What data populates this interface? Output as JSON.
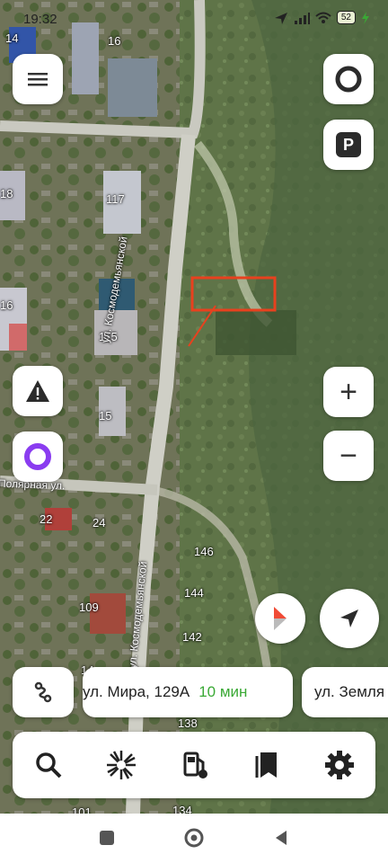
{
  "status_bar": {
    "time": "19:32",
    "battery": "52"
  },
  "map": {
    "house_numbers": [
      "14",
      "16",
      "18",
      "117",
      "16",
      "115",
      "15",
      "22",
      "24",
      "146",
      "144",
      "109",
      "142",
      "138",
      "134",
      "101",
      "14"
    ],
    "streets": {
      "kosmodemyanskoy_upper": "ул. Космодемьянской",
      "kosmodemyanskoy_lower": "ул. Космодемьянской",
      "polyarnaya": "Полярная ул."
    }
  },
  "controls": {
    "menu": "menu-icon",
    "alice_top": "alice-ring-icon",
    "parking": "P",
    "zoom_in": "+",
    "zoom_out": "−"
  },
  "routes": [
    {
      "address": "ул. Мира, 129А",
      "time": "10 мин"
    },
    {
      "address": "ул. Земля",
      "time": ""
    }
  ],
  "colors": {
    "accent_green": "#3aa935",
    "alice_purple": "#8a3cf0",
    "highlight_rect": "#e8411e",
    "compass_red": "#f04b36"
  }
}
